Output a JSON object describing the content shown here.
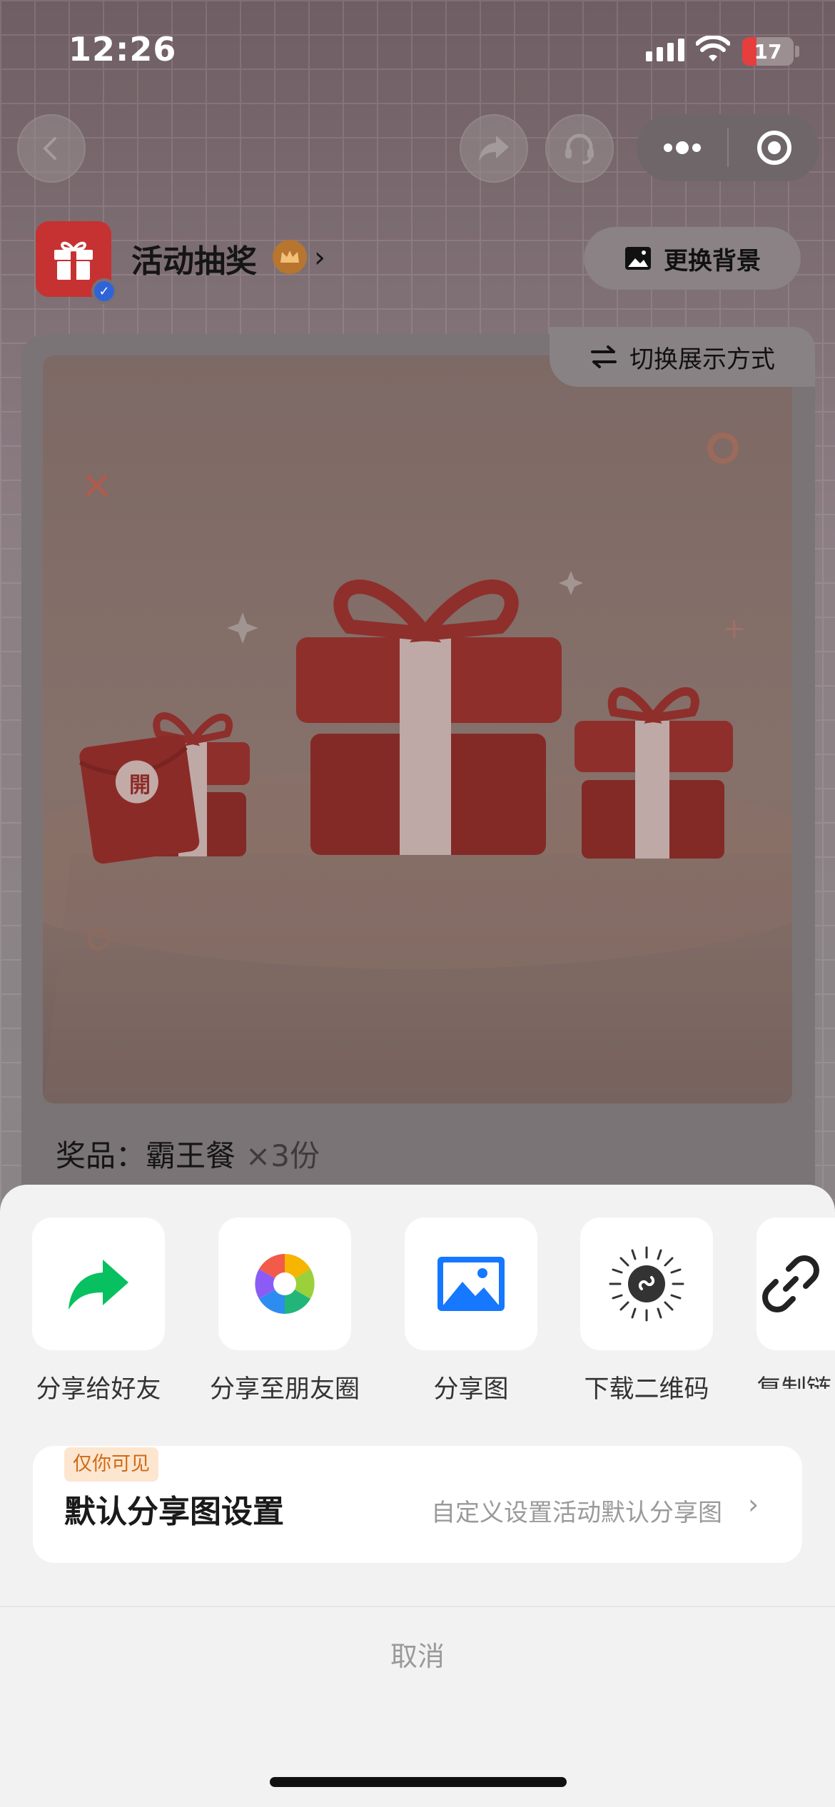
{
  "status_bar": {
    "time": "12:26",
    "battery": "17"
  },
  "profile": {
    "name": "活动抽奖"
  },
  "header": {
    "change_background": "更换背景"
  },
  "card": {
    "switch_display": "切换展示方式",
    "prize_label": "奖品：",
    "prize_name": "霸王餐",
    "prize_qty": "×3份",
    "red_envelope_char": "開"
  },
  "share_sheet": {
    "items": [
      {
        "label": "分享给好友",
        "icon": "share-arrow-icon"
      },
      {
        "label": "分享至朋友圈",
        "icon": "moments-aperture-icon"
      },
      {
        "label": "分享图",
        "icon": "image-icon"
      },
      {
        "label": "下载二维码",
        "icon": "mini-program-code-icon"
      },
      {
        "label": "复制链",
        "icon": "link-icon"
      }
    ],
    "setting": {
      "badge": "仅你可见",
      "title": "默认分享图设置",
      "description": "自定义设置活动默认分享图"
    },
    "cancel": "取消"
  },
  "colors": {
    "accent_green": "#07c160",
    "brand_red": "#c63232",
    "blue": "#1677ff"
  }
}
